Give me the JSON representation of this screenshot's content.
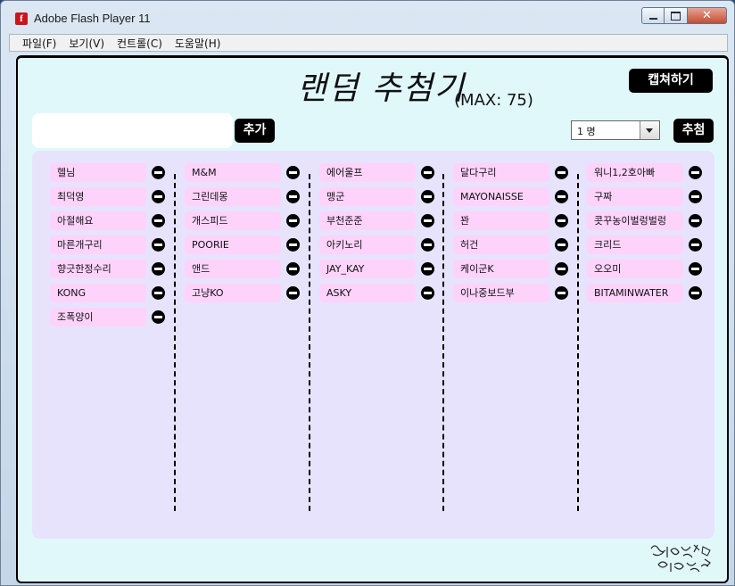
{
  "window": {
    "title": "Adobe Flash Player 11"
  },
  "menu": [
    "파일(F)",
    "보기(V)",
    "컨트롤(C)",
    "도움말(H)"
  ],
  "app": {
    "title": "랜덤 추첨기",
    "max_label": "(MAX: 75)",
    "capture_label": "캡쳐하기",
    "add_label": "추가",
    "draw_label": "추첨",
    "name_input_value": "",
    "count_selected": "1 명"
  },
  "columns": [
    [
      "헬님",
      "최덕영",
      "아절해요",
      "마른개구리",
      "향긋한정수리",
      "KONG",
      "조폭양이"
    ],
    [
      "M&M",
      "그린데몽",
      "개스피드",
      "POORIE",
      "앤드",
      "고냥KO"
    ],
    [
      "에어울프",
      "맹군",
      "부천준준",
      "아키노리",
      "JAY_KAY",
      "ASKY"
    ],
    [
      "달다구리",
      "MAYONAISSE",
      "꽌",
      "허건",
      "케이군K",
      "이나중보드부"
    ],
    [
      "워니1,2호아빠",
      "구짜",
      "콧꾸농이벌렁벌렁",
      "크리드",
      "오오미",
      "BITAMINWATER"
    ]
  ],
  "colors": {
    "panel": "#e7e3fc",
    "pill": "#fdd3fb",
    "background": "#e1f8fb"
  },
  "icons": {
    "remove": "minus-circle-icon",
    "app": "flash-icon"
  }
}
